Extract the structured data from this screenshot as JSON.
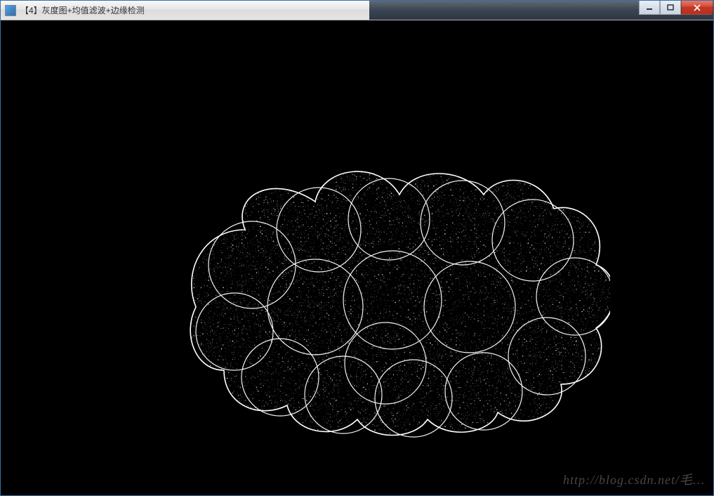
{
  "window": {
    "title": "【4】灰度图+均值滤波+边缘检测",
    "icon_name": "app-icon"
  },
  "controls": {
    "minimize_label": "Minimize",
    "maximize_label": "Maximize",
    "close_label": "Close"
  },
  "content": {
    "description": "edge-detected-image",
    "background": "#000000",
    "edge_color": "#ffffff"
  },
  "watermark": {
    "text": "http://blog.csdn.net/毛…"
  }
}
